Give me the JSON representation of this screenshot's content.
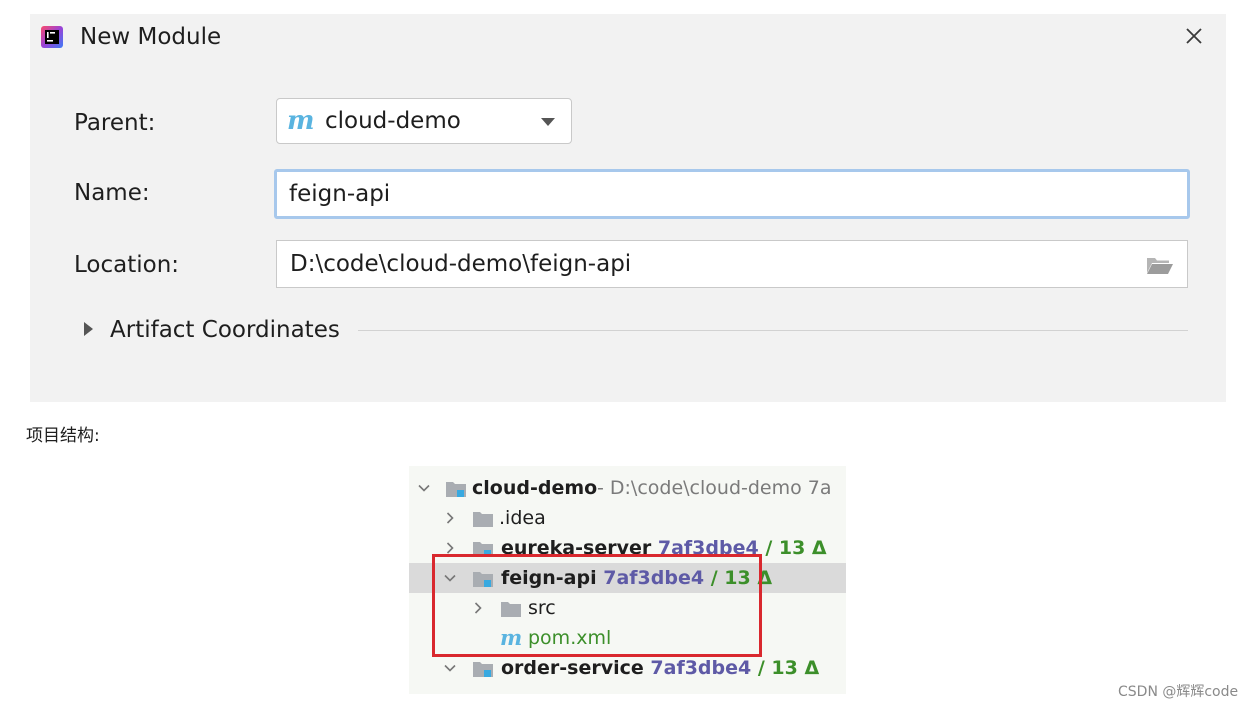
{
  "dialog": {
    "title": "New Module",
    "parent": {
      "label": "Parent:",
      "value": "cloud-demo"
    },
    "name": {
      "label": "Name:",
      "value": "feign-api"
    },
    "location": {
      "label": "Location:",
      "value": "D:\\code\\cloud-demo\\feign-api"
    },
    "artifact_section": "Artifact Coordinates"
  },
  "caption": "项目结构:",
  "tree": {
    "root": {
      "name": "cloud-demo",
      "path": " - D:\\code\\cloud-demo 7a"
    },
    "idea": {
      "name": ".idea"
    },
    "eureka": {
      "name": "eureka-server",
      "hash": "7af3dbe4",
      "delta": "/ 13 Δ"
    },
    "feign": {
      "name": "feign-api",
      "hash": "7af3dbe4",
      "delta": "/ 13 Δ"
    },
    "src": {
      "name": "src"
    },
    "pom": {
      "name": "pom.xml"
    },
    "order": {
      "name": "order-service",
      "hash": "7af3dbe4",
      "delta": "/ 13 Δ"
    }
  },
  "watermark": "CSDN @辉辉code",
  "colors": {
    "dialog_bg": "#f2f2f2",
    "focus_border": "#a7c8ec",
    "maven_icon": "#5ab4e0",
    "hash": "#5e5aa6",
    "vcs_green": "#3c8f2a",
    "highlight": "#d9282e"
  },
  "icons": {
    "app": "intellij-icon",
    "close": "close-icon",
    "dropdown": "chevron-down-icon",
    "folder": "folder-open-icon",
    "maven": "maven-icon"
  }
}
